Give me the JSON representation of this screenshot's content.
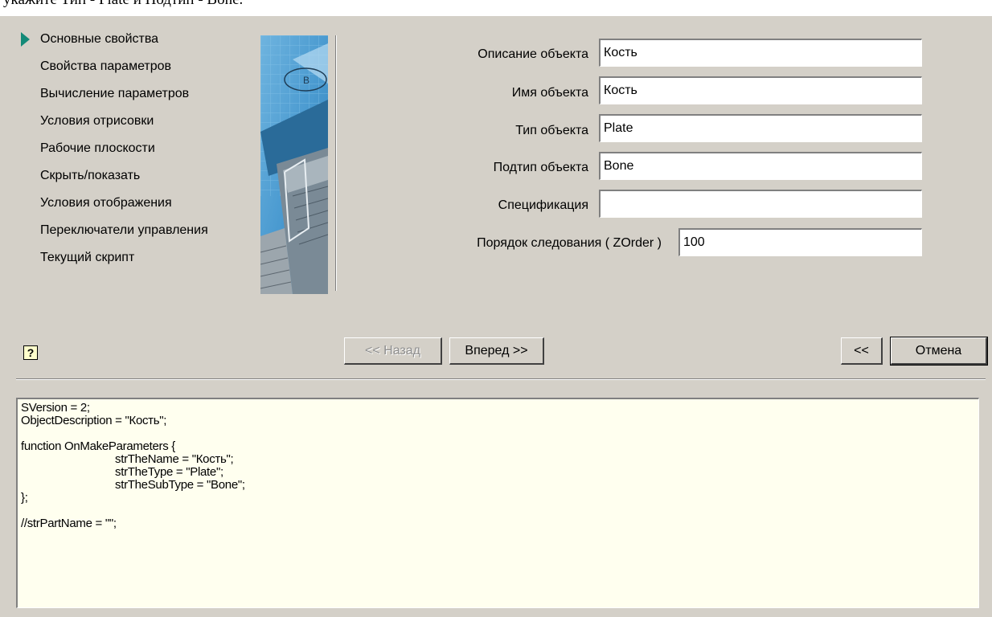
{
  "top_caption": "укажите Тип - Plate и Подтип - Bone.",
  "nav": {
    "items": [
      {
        "label": "Основные свойства",
        "active": true
      },
      {
        "label": "Свойства параметров",
        "active": false
      },
      {
        "label": "Вычисление параметров",
        "active": false
      },
      {
        "label": "Условия отрисовки",
        "active": false
      },
      {
        "label": "Рабочие плоскости",
        "active": false
      },
      {
        "label": "Скрыть/показать",
        "active": false
      },
      {
        "label": "Условия отображения",
        "active": false
      },
      {
        "label": "Переключатели управления",
        "active": false
      },
      {
        "label": "Текущий скрипт",
        "active": false
      }
    ]
  },
  "side_image": {
    "badge": "B"
  },
  "form": {
    "description": {
      "label": "Описание объекта",
      "value": "Кость"
    },
    "name": {
      "label": "Имя объекта",
      "value": "Кость"
    },
    "type": {
      "label": "Тип объекта",
      "value": "Plate"
    },
    "subtype": {
      "label": "Подтип объекта",
      "value": "Bone"
    },
    "specification": {
      "label": "Спецификация",
      "value": ""
    },
    "zorder": {
      "label": "Порядок следования ( ZOrder )",
      "value": "100"
    }
  },
  "buttons": {
    "help": "?",
    "back": "<< Назад",
    "next": "Вперед >>",
    "collapse": "<<",
    "cancel": "Отмена"
  },
  "script": {
    "lines": [
      "SVersion = 2;",
      "ObjectDescription = \"Кость\";",
      "",
      "function OnMakeParameters {",
      "strTheName = \"Кость\";",
      "strTheType = \"Plate\";",
      "strTheSubType = \"Bone\";",
      "};",
      "",
      "//strPartName = \"\";"
    ]
  }
}
